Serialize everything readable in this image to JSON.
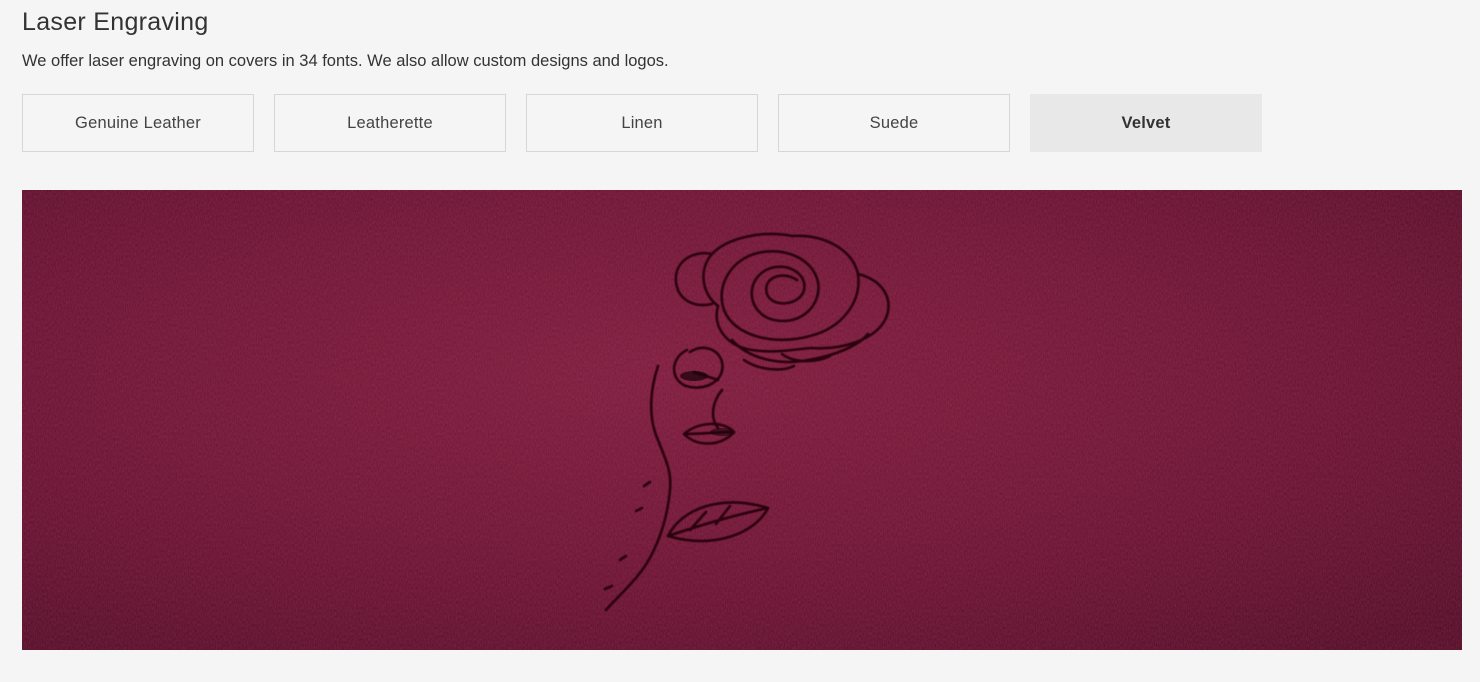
{
  "section": {
    "title": "Laser Engraving",
    "description": "We offer laser engraving on covers in 34 fonts. We also allow custom designs and logos."
  },
  "materials": [
    {
      "label": "Genuine Leather",
      "active": false
    },
    {
      "label": "Leatherette",
      "active": false
    },
    {
      "label": "Linen",
      "active": false
    },
    {
      "label": "Suede",
      "active": false
    },
    {
      "label": "Velvet",
      "active": true
    }
  ],
  "preview": {
    "material": "Velvet",
    "fabric_color": "#6e1632",
    "engraving_motif": "rose-icon"
  }
}
